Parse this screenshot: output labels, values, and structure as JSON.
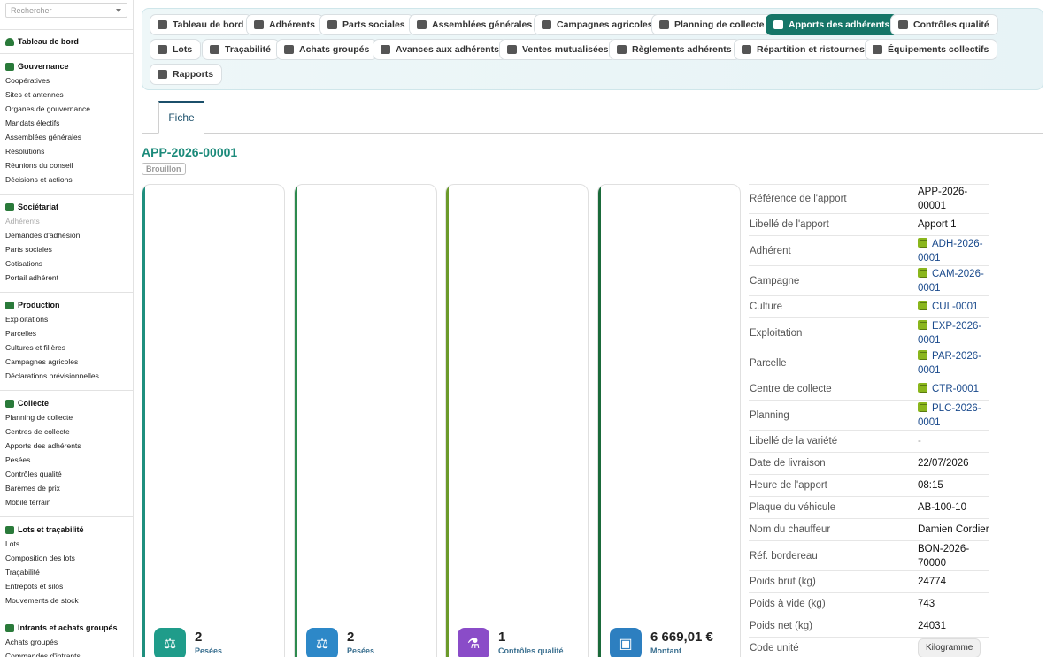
{
  "sidebar": {
    "search_placeholder": "Rechercher",
    "dashboard": "Tableau de bord",
    "sections": [
      {
        "title": "Gouvernance",
        "items": [
          "Coopératives",
          "Sites et antennes",
          "Organes de gouvernance",
          "Mandats électifs",
          "Assemblées générales",
          "Résolutions",
          "Réunions du conseil",
          "Décisions et actions"
        ]
      },
      {
        "title": "Sociétariat",
        "items": [
          "Adhérents",
          "Demandes d'adhésion",
          "Parts sociales",
          "Cotisations",
          "Portail adhérent"
        ]
      },
      {
        "title": "Production",
        "items": [
          "Exploitations",
          "Parcelles",
          "Cultures et filières",
          "Campagnes agricoles",
          "Déclarations prévisionnelles"
        ]
      },
      {
        "title": "Collecte",
        "items": [
          "Planning de collecte",
          "Centres de collecte",
          "Apports des adhérents",
          "Pesées",
          "Contrôles qualité",
          "Barèmes de prix",
          "Mobile terrain"
        ]
      },
      {
        "title": "Lots et traçabilité",
        "items": [
          "Lots",
          "Composition des lots",
          "Traçabilité",
          "Entrepôts et silos",
          "Mouvements de stock"
        ]
      },
      {
        "title": "Intrants et achats groupés",
        "items": [
          "Achats groupés",
          "Commandes d'intrants"
        ]
      }
    ]
  },
  "nav": {
    "buttons": [
      "Tableau de bord",
      "Adhérents",
      "Parts sociales",
      "Assemblées générales",
      "Campagnes agricoles",
      "Planning de collecte",
      "Apports des adhérents",
      "Contrôles qualité",
      "Lots",
      "Traçabilité",
      "Achats groupés",
      "Avances aux adhérents",
      "Ventes mutualisées",
      "Règlements adhérents",
      "Répartition et ristournes",
      "Équipements collectifs",
      "Rapports"
    ],
    "active": "Apports des adhérents"
  },
  "tabs": {
    "fiche": "Fiche"
  },
  "record": {
    "title": "APP-2026-00001",
    "status": "Brouillon"
  },
  "kpis": [
    {
      "value": "2",
      "label": "Pesées",
      "color": "#1f9c8a",
      "icon": "scale-icon"
    },
    {
      "value": "2",
      "label": "Pesées",
      "color": "#2d88c8",
      "icon": "scale-icon"
    },
    {
      "value": "1",
      "label": "Contrôles qualité",
      "color": "#8a4cc8",
      "icon": "flask-icon"
    },
    {
      "value": "6 669,01 €",
      "label": "Montant provisionnel",
      "color": "#2d7fc0",
      "icon": "money-icon"
    }
  ],
  "details": [
    {
      "label": "Référence de l'apport",
      "value": "APP-2026-00001",
      "type": "text"
    },
    {
      "label": "Libellé de l'apport",
      "value": "Apport 1",
      "type": "text"
    },
    {
      "label": "Adhérent",
      "value": "ADH-2026-0001",
      "type": "link"
    },
    {
      "label": "Campagne",
      "value": "CAM-2026-0001",
      "type": "link"
    },
    {
      "label": "Culture",
      "value": "CUL-0001",
      "type": "link"
    },
    {
      "label": "Exploitation",
      "value": "EXP-2026-0001",
      "type": "link"
    },
    {
      "label": "Parcelle",
      "value": "PAR-2026-0001",
      "type": "link"
    },
    {
      "label": "Centre de collecte",
      "value": "CTR-0001",
      "type": "link"
    },
    {
      "label": "Planning",
      "value": "PLC-2026-0001",
      "type": "link"
    },
    {
      "label": "Libellé de la variété",
      "value": "-",
      "type": "muted"
    },
    {
      "label": "Date de livraison",
      "value": "22/07/2026",
      "type": "text"
    },
    {
      "label": "Heure de l'apport",
      "value": "08:15",
      "type": "text"
    },
    {
      "label": "Plaque du véhicule",
      "value": "AB-100-10",
      "type": "text"
    },
    {
      "label": "Nom du chauffeur",
      "value": "Damien Cordier",
      "type": "text"
    },
    {
      "label": "Réf. bordereau",
      "value": "BON-2026-70000",
      "type": "text"
    },
    {
      "label": "Poids brut (kg)",
      "value": "24774",
      "type": "text"
    },
    {
      "label": "Poids à vide (kg)",
      "value": "743",
      "type": "text"
    },
    {
      "label": "Poids net (kg)",
      "value": "24031",
      "type": "text"
    },
    {
      "label": "Code unité",
      "value": "Kilogramme",
      "type": "chip"
    }
  ]
}
